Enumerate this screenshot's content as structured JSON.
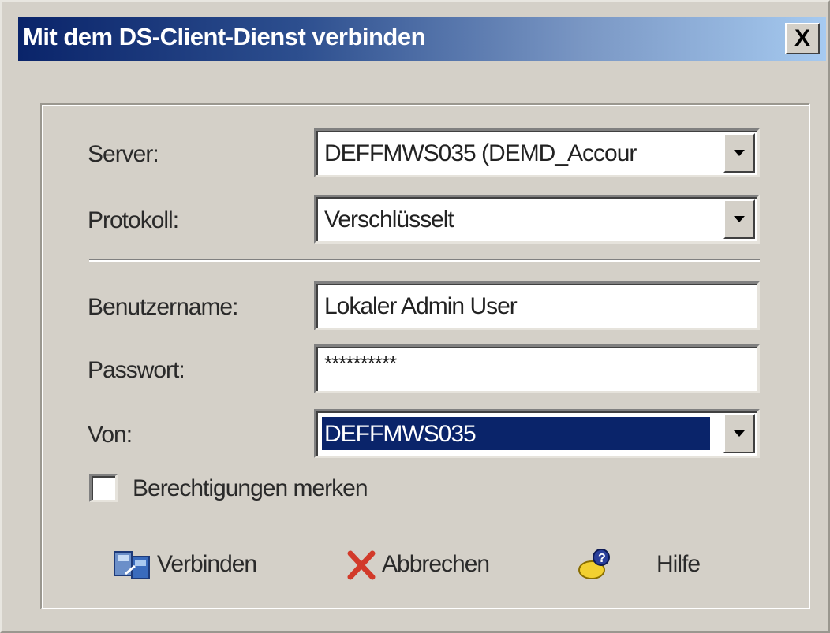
{
  "window": {
    "title": "Mit dem DS-Client-Dienst verbinden",
    "close_label": "X"
  },
  "form": {
    "server": {
      "label": "Server:",
      "value": "DEFFMWS035 (DEMD_Accour"
    },
    "protocol": {
      "label": "Protokoll:",
      "value": "Verschlüsselt"
    },
    "username": {
      "label": "Benutzername:",
      "value": "Lokaler Admin User"
    },
    "password": {
      "label": "Passwort:",
      "value": "**********"
    },
    "from": {
      "label": "Von:",
      "value": "DEFFMWS035"
    },
    "remember": {
      "label": "Berechtigungen merken",
      "checked": false
    }
  },
  "buttons": {
    "connect": {
      "label": "Verbinden",
      "icon": "connect-icon"
    },
    "cancel": {
      "label": "Abbrechen",
      "icon": "x-icon"
    },
    "help": {
      "label": "Hilfe",
      "icon": "help-icon"
    }
  },
  "colors": {
    "title_start": "#0a246a",
    "title_end": "#a6caf0",
    "selection": "#0a246a",
    "background": "#d4d0c8"
  }
}
